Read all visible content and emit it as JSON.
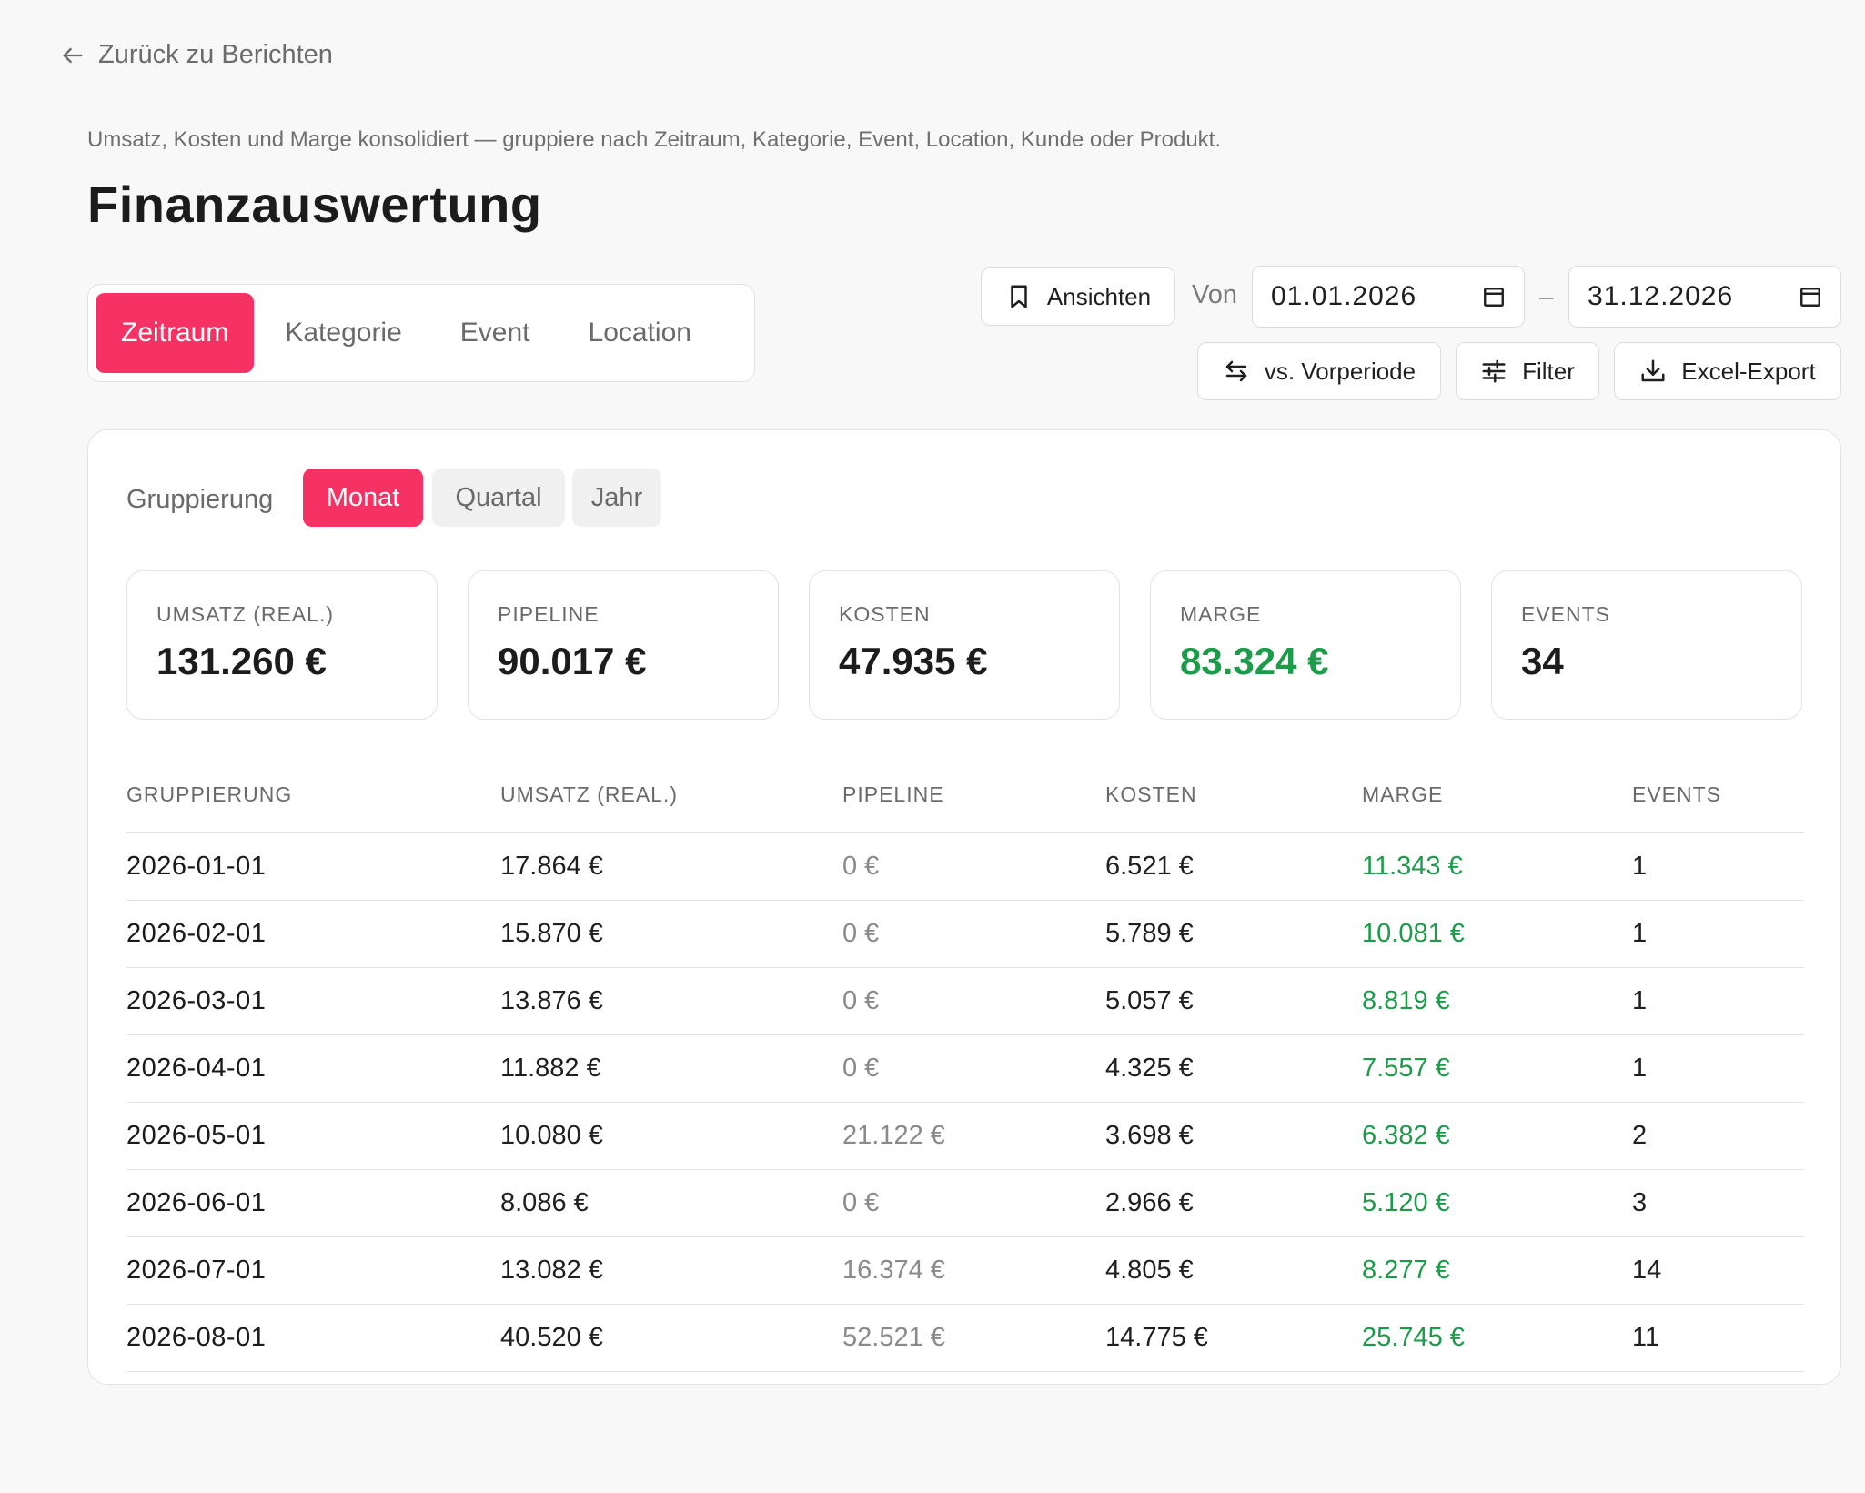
{
  "back": {
    "label": "Zurück zu Berichten",
    "icon": "arrow-left-icon"
  },
  "header": {
    "subtitle": "Umsatz, Kosten und Marge konsolidiert — gruppiere nach Zeitraum, Kategorie, Event, Location, Kunde oder Produkt.",
    "title": "Finanzauswertung"
  },
  "tabs": [
    {
      "label": "Zeitraum",
      "active": true
    },
    {
      "label": "Kategorie",
      "active": false
    },
    {
      "label": "Event",
      "active": false
    },
    {
      "label": "Location",
      "active": false
    }
  ],
  "toolbar": {
    "views_label": "Ansichten",
    "from_label": "Von",
    "date_from": "01.01.2026",
    "date_separator": "–",
    "date_to": "31.12.2026",
    "compare_label": "vs. Vorperiode",
    "filter_label": "Filter",
    "export_label": "Excel-Export"
  },
  "grouping": {
    "label": "Gruppierung",
    "options": [
      {
        "label": "Monat",
        "active": true
      },
      {
        "label": "Quartal",
        "active": false
      },
      {
        "label": "Jahr",
        "active": false
      }
    ]
  },
  "kpis": [
    {
      "label": "UMSATZ (REAL.)",
      "value": "131.260 €"
    },
    {
      "label": "PIPELINE",
      "value": "90.017 €"
    },
    {
      "label": "KOSTEN",
      "value": "47.935 €"
    },
    {
      "label": "MARGE",
      "value": "83.324 €"
    },
    {
      "label": "EVENTS",
      "value": "34"
    }
  ],
  "table": {
    "headers": [
      "GRUPPIERUNG",
      "UMSATZ (REAL.)",
      "PIPELINE",
      "KOSTEN",
      "MARGE",
      "EVENTS"
    ],
    "rows": [
      [
        "2026-01-01",
        "17.864 €",
        "0 €",
        "6.521 €",
        "11.343 €",
        "1"
      ],
      [
        "2026-02-01",
        "15.870 €",
        "0 €",
        "5.789 €",
        "10.081 €",
        "1"
      ],
      [
        "2026-03-01",
        "13.876 €",
        "0 €",
        "5.057 €",
        "8.819 €",
        "1"
      ],
      [
        "2026-04-01",
        "11.882 €",
        "0 €",
        "4.325 €",
        "7.557 €",
        "1"
      ],
      [
        "2026-05-01",
        "10.080 €",
        "21.122 €",
        "3.698 €",
        "6.382 €",
        "2"
      ],
      [
        "2026-06-01",
        "8.086 €",
        "0 €",
        "2.966 €",
        "5.120 €",
        "3"
      ],
      [
        "2026-07-01",
        "13.082 €",
        "16.374 €",
        "4.805 €",
        "8.277 €",
        "14"
      ],
      [
        "2026-08-01",
        "40.520 €",
        "52.521 €",
        "14.775 €",
        "25.745 €",
        "11"
      ]
    ]
  },
  "colors": {
    "accent": "#f53263",
    "positive": "#1e9b4a",
    "background": "#f8f8f8"
  }
}
